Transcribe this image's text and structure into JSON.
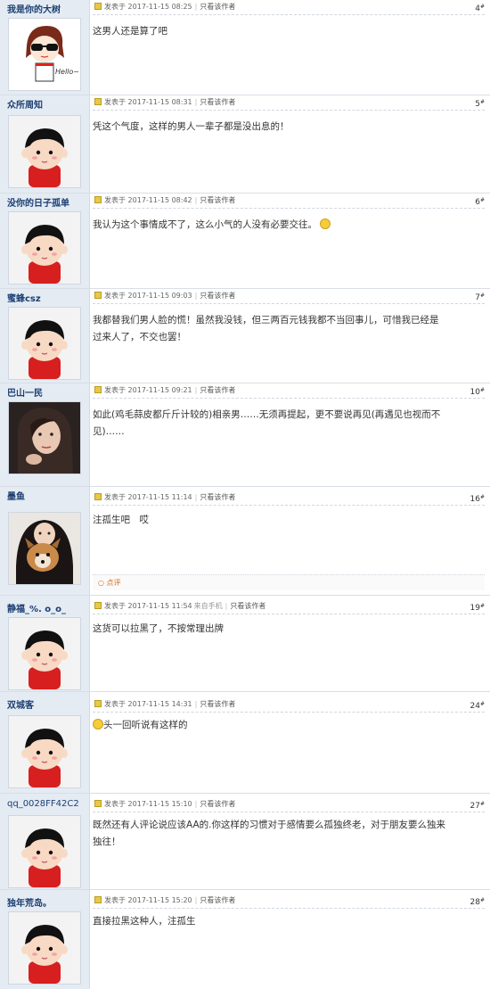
{
  "labels": {
    "posted_prefix": "发表于",
    "only_author": "只看该作者",
    "comment": "点评"
  },
  "posts": [
    {
      "user": "我是你的大树",
      "time": "2017-11-15 08:25",
      "floor": "4",
      "avatar": "sunglasses-girl-icon",
      "text": "这男人还是算了吧"
    },
    {
      "user": "众所周知",
      "time": "2017-11-15 08:31",
      "floor": "5",
      "avatar": "default-cartoon-icon",
      "text": "凭这个气度，这样的男人一辈子都是没出息的！"
    },
    {
      "user": "没你的日子孤单",
      "time": "2017-11-15 08:42",
      "floor": "6",
      "avatar": "default-cartoon-icon",
      "text": "我认为这个事情成不了，这么小气的人没有必要交往。"
    },
    {
      "user": "蜜蜂csz",
      "time": "2017-11-15 09:03",
      "floor": "7",
      "avatar": "default-cartoon-icon",
      "line1": "我都替我们男人脸的慌！虽然我没钱，但三两百元钱我都不当回事儿，可惜我已经是",
      "line2": "过来人了，不交也罢！"
    },
    {
      "user": "巴山一民",
      "time": "2017-11-15 09:21",
      "floor": "10",
      "avatar": "woman-photo-icon",
      "line1": "如此(鸡毛蒜皮都斤斤计较的)相亲男……无须再提起，更不要说再见(再遇见也视而不",
      "line2": "见)……"
    },
    {
      "user": "墨鱼",
      "time": "2017-11-15 11:14",
      "floor": "16",
      "avatar": "girl-with-dog-icon",
      "text": "注孤生吧　哎"
    },
    {
      "user": "静福_%. o_o_",
      "time": "2017-11-15 11:54",
      "floor": "19",
      "avatar": "default-cartoon-icon",
      "device": "来自手机",
      "text": "这货可以拉黑了，不按常理出牌"
    },
    {
      "user": "双城客",
      "time": "2017-11-15 14:31",
      "floor": "24",
      "avatar": "default-cartoon-icon",
      "text": "头一回听说有这样的"
    },
    {
      "user": "qq_0028FF42C2",
      "time": "2017-11-15 15:10",
      "floor": "27",
      "avatar": "default-cartoon-icon",
      "line1": "既然还有人评论说应该AA的.你这样的习惯对于感情要么孤独终老，对于朋友要么独来",
      "line2": "独往！"
    },
    {
      "user": "独年荒岛。",
      "time": "2017-11-15 15:20",
      "floor": "28",
      "avatar": "default-cartoon-icon",
      "text": "直接拉黑这种人，注孤生"
    }
  ]
}
